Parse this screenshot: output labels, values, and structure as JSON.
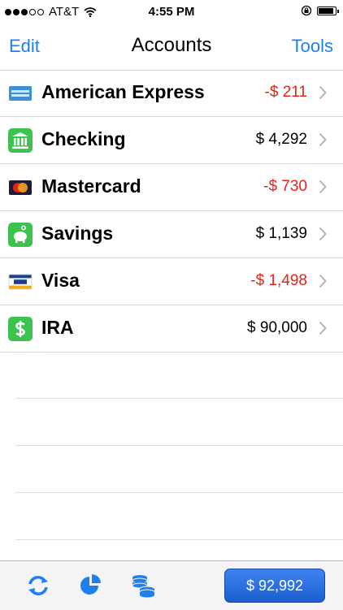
{
  "status_bar": {
    "carrier": "AT&T",
    "time": "4:55 PM",
    "signal_bars_filled": 3,
    "signal_bars_total": 5,
    "battery_level": 0.9
  },
  "nav": {
    "left": "Edit",
    "title": "Accounts",
    "right": "Tools"
  },
  "accounts": [
    {
      "name": "American Express",
      "balance": "-$ 211",
      "negative": true,
      "icon": "amex-card-icon"
    },
    {
      "name": "Checking",
      "balance": "$ 4,292",
      "negative": false,
      "icon": "bank-icon"
    },
    {
      "name": "Mastercard",
      "balance": "-$ 730",
      "negative": true,
      "icon": "mastercard-icon"
    },
    {
      "name": "Savings",
      "balance": "$ 1,139",
      "negative": false,
      "icon": "piggy-bank-icon"
    },
    {
      "name": "Visa",
      "balance": "-$ 1,498",
      "negative": true,
      "icon": "visa-card-icon"
    },
    {
      "name": "IRA",
      "balance": "$ 90,000",
      "negative": false,
      "icon": "dollar-icon"
    }
  ],
  "toolbar": {
    "total": "$ 92,992",
    "icons": [
      "sync-icon",
      "pie-chart-icon",
      "coins-icon"
    ]
  },
  "colors": {
    "accent": "#1f7ff0",
    "negative": "#e3231b",
    "green": "#3cc24e",
    "button": "#2a6fe0"
  }
}
